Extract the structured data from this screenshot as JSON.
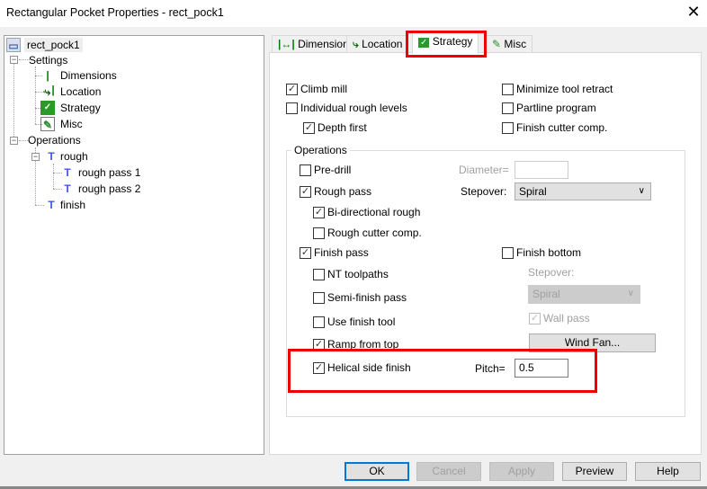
{
  "window": {
    "title": "Rectangular Pocket Properties - rect_pock1",
    "close": "✕"
  },
  "tree": {
    "root": "rect_pock1",
    "settings": "Settings",
    "settings_items": [
      "Dimensions",
      "Location",
      "Strategy",
      "Misc"
    ],
    "operations": "Operations",
    "rough": "rough",
    "rough_items": [
      "rough pass 1",
      "rough pass 2"
    ],
    "finish": "finish"
  },
  "tabs": [
    "Dimensions",
    "Location",
    "Strategy",
    "Misc"
  ],
  "active_tab": "Strategy",
  "options": {
    "climb_mill": {
      "label": "Climb mill",
      "checked": true
    },
    "individual_rough_levels": {
      "label": "Individual rough levels",
      "checked": false
    },
    "depth_first": {
      "label": "Depth first",
      "checked": true
    },
    "minimize_tool_retract": {
      "label": "Minimize tool retract",
      "checked": false
    },
    "partline_program": {
      "label": "Partline program",
      "checked": false
    },
    "finish_cutter_comp": {
      "label": "Finish cutter comp.",
      "checked": false
    }
  },
  "operations": {
    "label": "Operations",
    "pre_drill": {
      "label": "Pre-drill",
      "checked": false
    },
    "diameter_label": "Diameter=",
    "diameter_value": "",
    "rough_pass": {
      "label": "Rough pass",
      "checked": true
    },
    "stepover_label": "Stepover:",
    "stepover_value": "Spiral",
    "bi_directional_rough": {
      "label": "Bi-directional rough",
      "checked": true
    },
    "rough_cutter_comp": {
      "label": "Rough cutter comp.",
      "checked": false
    },
    "finish_pass": {
      "label": "Finish pass",
      "checked": true
    },
    "finish_bottom": {
      "label": "Finish bottom",
      "checked": false
    },
    "nt_toolpaths": {
      "label": "NT toolpaths",
      "checked": false
    },
    "finish_stepover_label": "Stepover:",
    "finish_stepover_value": "Spiral",
    "semi_finish_pass": {
      "label": "Semi-finish pass",
      "checked": false
    },
    "wall_pass": {
      "label": "Wall pass",
      "checked": true
    },
    "use_finish_tool": {
      "label": "Use finish tool",
      "checked": false
    },
    "wind_fan": "Wind Fan...",
    "ramp_from_top": {
      "label": "Ramp from top",
      "checked": true
    },
    "helical_side_finish": {
      "label": "Helical side finish",
      "checked": true
    },
    "pitch_label": "Pitch=",
    "pitch_value": "0.5"
  },
  "buttons": {
    "ok": "OK",
    "cancel": "Cancel",
    "apply": "Apply",
    "preview": "Preview",
    "help": "Help"
  },
  "check": "✓"
}
